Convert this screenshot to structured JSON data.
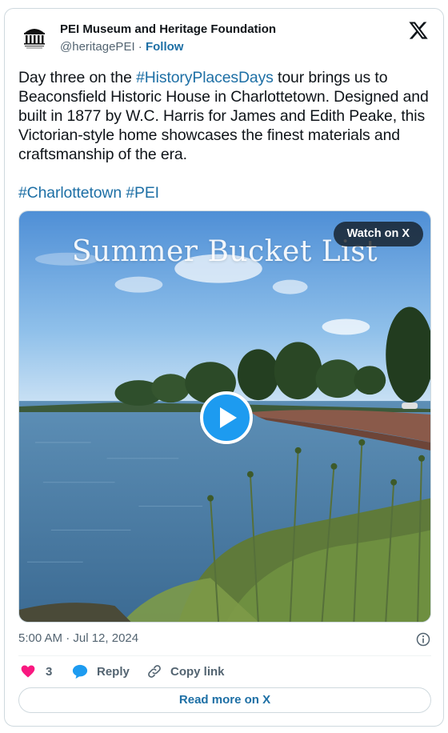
{
  "author": {
    "name": "PEI Museum and Heritage Foundation",
    "handle": "@heritagePEI",
    "separator": "·",
    "follow_label": "Follow",
    "avatar_icon": "museum-building-logo"
  },
  "platform_icon": "x-logo-icon",
  "tweet": {
    "text_before_tag": "Day three on the ",
    "hashtag_main": "#HistoryPlacesDays",
    "text_after_tag": " tour brings us to Beaconsfield Historic House in Charlottetown. Designed and built in 1877 by W.C. Harris for James and Edith Peake, this Victorian-style home showcases the finest materials and craftsmanship of the era.",
    "hashtag_1": "#Charlottetown",
    "hashtag_space": " ",
    "hashtag_2": "#PEI"
  },
  "media": {
    "overlay_title": "Summer Bucket List",
    "watch_label": "Watch on X",
    "play_icon": "play-icon"
  },
  "meta": {
    "timestamp": "5:00 AM · Jul 12, 2024",
    "info_icon": "info-icon"
  },
  "actions": {
    "like_count": "3",
    "reply_label": "Reply",
    "copy_label": "Copy link"
  },
  "read_more_label": "Read more on X",
  "colors": {
    "link": "#1d6fa5",
    "like": "#f91880",
    "reply": "#1d9bf0",
    "play": "#1d9bf0",
    "border": "#cfd9de",
    "muted": "#536471"
  }
}
